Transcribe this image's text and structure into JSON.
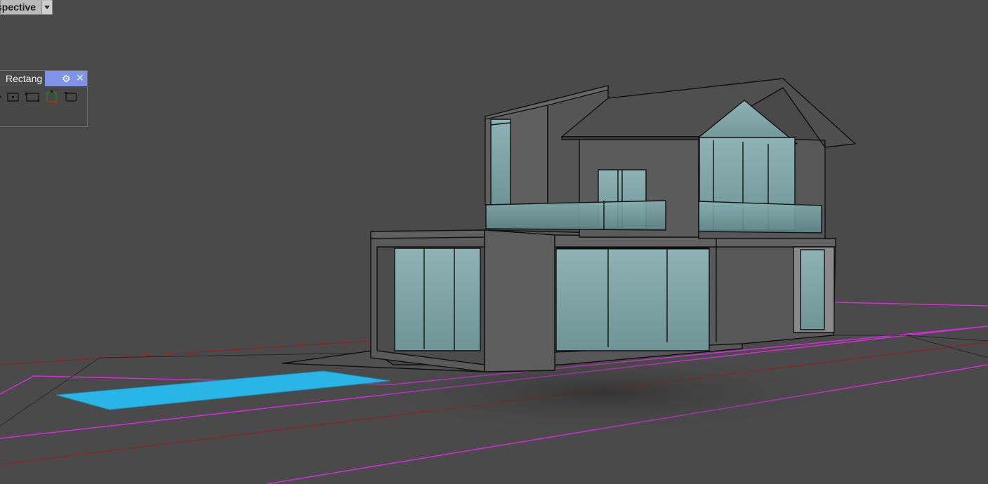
{
  "viewport": {
    "title": "Perspective",
    "title_visible": "spective"
  },
  "toolbar": {
    "title": "Rectang",
    "icons": [
      "rectangle-3pt-icon",
      "rectangle-corner-icon",
      "rectangle-center-icon",
      "rectangle-vertical-icon",
      "rounded-rectangle-icon"
    ]
  },
  "colors": {
    "background": "#4a4a4a",
    "pool": "#29b6e6",
    "property_line_magenta": "#d22ed6",
    "property_line_red": "#a01e1e",
    "glass": "#7fa3a5",
    "wall": "#555555",
    "toolbar_accent": "#7f93e8"
  }
}
